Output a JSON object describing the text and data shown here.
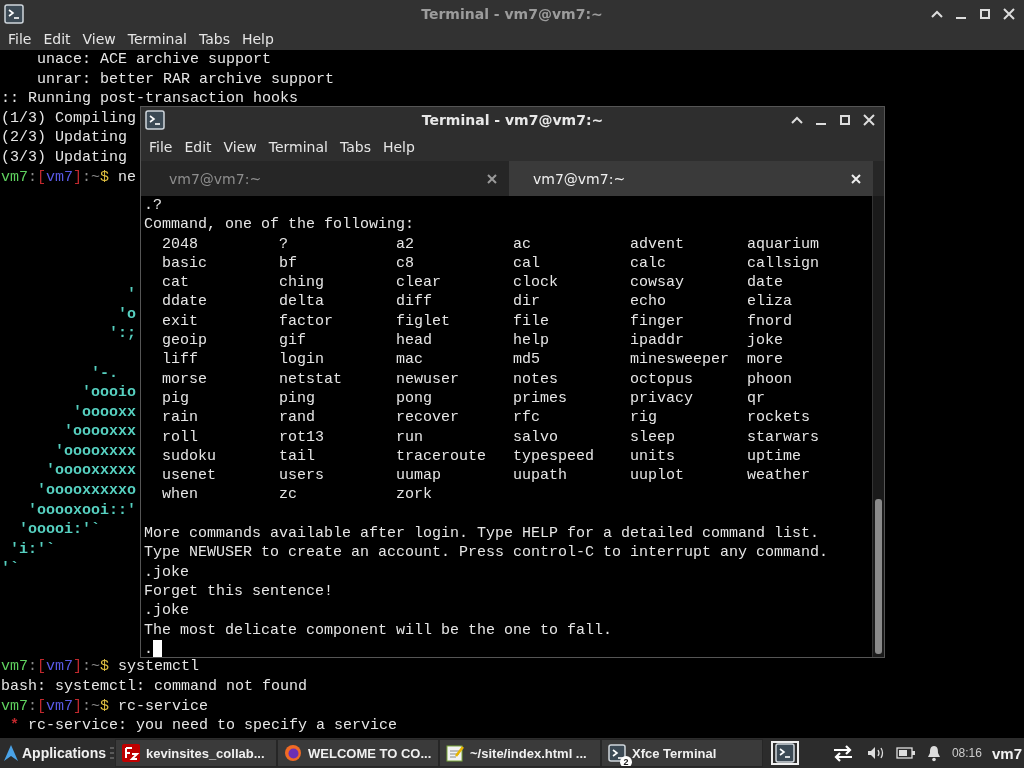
{
  "background_window": {
    "title": "Terminal - vm7@vm7:~",
    "menu": [
      "File",
      "Edit",
      "View",
      "Terminal",
      "Tabs",
      "Help"
    ],
    "lines": [
      {
        "kind": "text",
        "text": "    unace: ACE archive support"
      },
      {
        "kind": "text",
        "text": "    unrar: better RAR archive support"
      },
      {
        "kind": "text",
        "text": ":: Running post-transaction hooks"
      },
      {
        "kind": "text",
        "text": "(1/3) Compiling"
      },
      {
        "kind": "text",
        "text": "(2/3) Updating"
      },
      {
        "kind": "text",
        "text": "(3/3) Updating"
      },
      {
        "kind": "prompt",
        "segments": [
          {
            "text": "vm7",
            "color": "#5fd35f"
          },
          {
            "text": ":",
            "color": "#8a8a8a"
          },
          {
            "text": "[",
            "color": "#c0282d"
          },
          {
            "text": "vm7",
            "color": "#5a5ae6"
          },
          {
            "text": "]",
            "color": "#c0282d"
          },
          {
            "text": ":~",
            "color": "#8a8a8a"
          },
          {
            "text": "$",
            "color": "#e0c040"
          },
          {
            "text": " ne",
            "color": "#e6e6e6"
          }
        ]
      },
      {
        "kind": "blank"
      },
      {
        "kind": "blank"
      },
      {
        "kind": "blank"
      },
      {
        "kind": "blank"
      },
      {
        "kind": "blank"
      },
      {
        "kind": "art",
        "text": "              '"
      },
      {
        "kind": "art",
        "text": "             'o"
      },
      {
        "kind": "art",
        "text": "            ':;"
      },
      {
        "kind": "blank"
      },
      {
        "kind": "art",
        "text": "          '-."
      },
      {
        "kind": "art",
        "text": "         'oooio"
      },
      {
        "kind": "art",
        "text": "        'ooooxx"
      },
      {
        "kind": "art",
        "text": "       'ooooxxx"
      },
      {
        "kind": "art",
        "text": "      'ooooxxxx"
      },
      {
        "kind": "art",
        "text": "     'ooooxxxxx"
      },
      {
        "kind": "art",
        "text": "    'ooooxxxxxo"
      },
      {
        "kind": "art",
        "text": "   'ooooxooi::'"
      },
      {
        "kind": "art",
        "text": "  'ooooi:'`"
      },
      {
        "kind": "art",
        "text": " 'i:'`"
      },
      {
        "kind": "art",
        "text": "'`"
      },
      {
        "kind": "blank"
      },
      {
        "kind": "blank"
      },
      {
        "kind": "blank"
      },
      {
        "kind": "blank"
      },
      {
        "kind": "prompt",
        "segments": [
          {
            "text": "vm7",
            "color": "#5fd35f"
          },
          {
            "text": ":",
            "color": "#8a8a8a"
          },
          {
            "text": "[",
            "color": "#c0282d"
          },
          {
            "text": "vm7",
            "color": "#5a5ae6"
          },
          {
            "text": "]",
            "color": "#c0282d"
          },
          {
            "text": ":~",
            "color": "#8a8a8a"
          },
          {
            "text": "$",
            "color": "#e0c040"
          },
          {
            "text": " systemctl",
            "color": "#e6e6e6"
          }
        ]
      },
      {
        "kind": "text",
        "text": "bash: systemctl: command not found"
      },
      {
        "kind": "prompt",
        "segments": [
          {
            "text": "vm7",
            "color": "#5fd35f"
          },
          {
            "text": ":",
            "color": "#8a8a8a"
          },
          {
            "text": "[",
            "color": "#c0282d"
          },
          {
            "text": "vm7",
            "color": "#5a5ae6"
          },
          {
            "text": "]",
            "color": "#c0282d"
          },
          {
            "text": ":~",
            "color": "#8a8a8a"
          },
          {
            "text": "$",
            "color": "#e0c040"
          },
          {
            "text": " rc-service",
            "color": "#e6e6e6"
          }
        ]
      },
      {
        "kind": "warning",
        "segments": [
          {
            "text": "*",
            "color": "#c0282d"
          },
          {
            "text": " rc-service: you need to specify a service",
            "color": "#e6e6e6"
          }
        ]
      }
    ]
  },
  "front_window": {
    "title": "Terminal - vm7@vm7:~",
    "menu": [
      "File",
      "Edit",
      "View",
      "Terminal",
      "Tabs",
      "Help"
    ],
    "tabs": [
      {
        "label": "vm7@vm7:~",
        "selected": false
      },
      {
        "label": "vm7@vm7:~",
        "selected": true
      }
    ],
    "lines_before": [
      ".?",
      "Command, one of the following:"
    ],
    "commands": [
      [
        "2048",
        "?",
        "a2",
        "ac",
        "advent",
        "aquarium"
      ],
      [
        "basic",
        "bf",
        "c8",
        "cal",
        "calc",
        "callsign"
      ],
      [
        "cat",
        "ching",
        "clear",
        "clock",
        "cowsay",
        "date"
      ],
      [
        "ddate",
        "delta",
        "diff",
        "dir",
        "echo",
        "eliza"
      ],
      [
        "exit",
        "factor",
        "figlet",
        "file",
        "finger",
        "fnord"
      ],
      [
        "geoip",
        "gif",
        "head",
        "help",
        "ipaddr",
        "joke"
      ],
      [
        "liff",
        "login",
        "mac",
        "md5",
        "minesweeper",
        "more"
      ],
      [
        "morse",
        "netstat",
        "newuser",
        "notes",
        "octopus",
        "phoon"
      ],
      [
        "pig",
        "ping",
        "pong",
        "primes",
        "privacy",
        "qr"
      ],
      [
        "rain",
        "rand",
        "recover",
        "rfc",
        "rig",
        "rockets"
      ],
      [
        "roll",
        "rot13",
        "run",
        "salvo",
        "sleep",
        "starwars"
      ],
      [
        "sudoku",
        "tail",
        "traceroute",
        "typespeed",
        "units",
        "uptime"
      ],
      [
        "usenet",
        "users",
        "uumap",
        "uupath",
        "uuplot",
        "weather"
      ],
      [
        "when",
        "zc",
        "zork"
      ]
    ],
    "lines_after": [
      {
        "kind": "blank"
      },
      {
        "kind": "text",
        "text": "More commands available after login. Type HELP for a detailed command list."
      },
      {
        "kind": "text",
        "text": "Type NEWUSER to create an account. Press control-C to interrupt any command."
      },
      {
        "kind": "text",
        "text": ".joke"
      },
      {
        "kind": "text",
        "text": "Forget this sentence!"
      },
      {
        "kind": "text",
        "text": ".joke"
      },
      {
        "kind": "text",
        "text": "The most delicate component will be the one to fall."
      },
      {
        "kind": "input",
        "text": "."
      }
    ]
  },
  "taskbar": {
    "applications": "Applications",
    "tasks": [
      {
        "kind": "filezilla",
        "label": "kevinsites_collab..."
      },
      {
        "kind": "browser",
        "label": "WELCOME TO CO..."
      },
      {
        "kind": "editor",
        "label": "~/site/index.html ..."
      },
      {
        "kind": "terminal",
        "label": "Xfce Terminal",
        "badge": "2"
      }
    ],
    "clock": "08:16",
    "user": "vm7"
  }
}
